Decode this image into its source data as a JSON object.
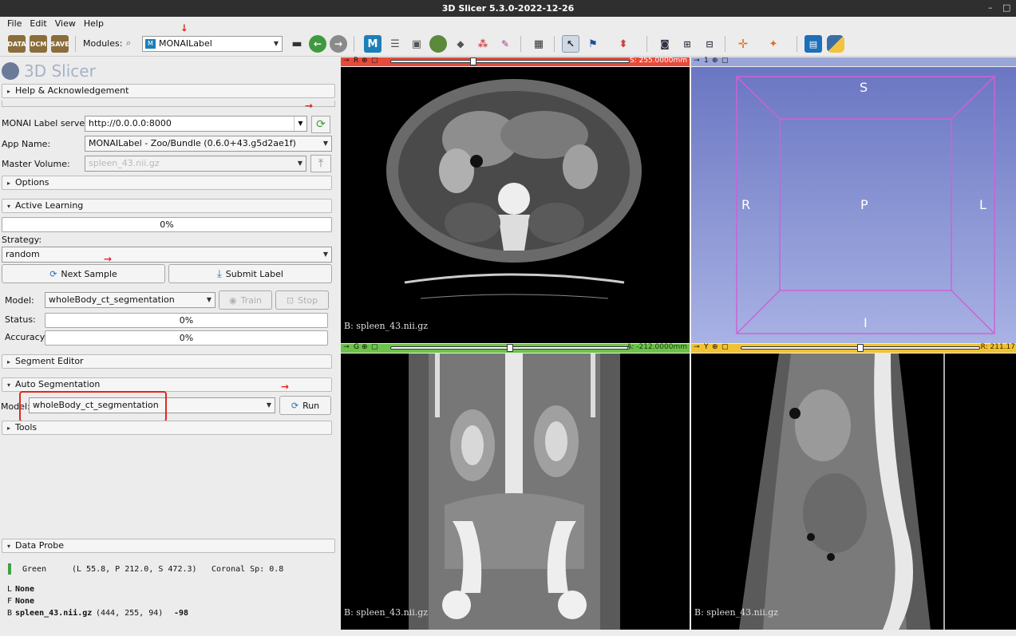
{
  "window": {
    "title": "3D Slicer 5.3.0-2022-12-26",
    "minimize": "–",
    "maximize": "□"
  },
  "menu": {
    "file": "File",
    "edit": "Edit",
    "view": "View",
    "help": "Help"
  },
  "toolbar": {
    "data_label": "DATA",
    "dcm_label": "DCM",
    "save_label": "SAVE",
    "modules_label": "Modules:",
    "module_selected": "MONAILabel",
    "module_icon": "M"
  },
  "logo": {
    "text": "3D Slicer"
  },
  "help_section": "Help & Acknowledgement",
  "server": {
    "label": "MONAI Label server:",
    "value": "http://0.0.0.0:8000"
  },
  "app": {
    "label": "App Name:",
    "value": "MONAILabel - Zoo/Bundle (0.6.0+43.g5d2ae1f)"
  },
  "master": {
    "label": "Master Volume:",
    "value": "spleen_43.nii.gz"
  },
  "options_section": "Options",
  "active_learning": {
    "section": "Active Learning",
    "progress_text": "0%",
    "progress_value": 0,
    "strategy_label": "Strategy:",
    "strategy_value": "random",
    "next_sample": "Next Sample",
    "submit_label": "Submit Label"
  },
  "training": {
    "model_label": "Model:",
    "model_value": "wholeBody_ct_segmentation",
    "train": "Train",
    "stop": "Stop",
    "status_label": "Status:",
    "status_value": "0%",
    "accuracy_label": "Accuracy:",
    "accuracy_value": "0%"
  },
  "segment_editor_section": "Segment Editor",
  "auto_seg": {
    "section": "Auto Segmentation",
    "model_label": "Model:",
    "model_value": "wholeBody_ct_segmentation",
    "run": "Run"
  },
  "tools_section": "Tools",
  "data_probe": {
    "section": "Data Probe",
    "line1_view": "Green",
    "line1_coords": "(L 55.8, P 212.0, S 472.3)",
    "line1_extra": "Coronal Sp: 0.8",
    "l_prefix": "L",
    "l_value": "None",
    "f_prefix": "F",
    "f_value": "None",
    "b_prefix": "B",
    "b_name": "spleen_43.nii.gz",
    "b_ijk": "(444, 255, 94)",
    "b_value": "-98"
  },
  "views": {
    "red": {
      "letter": "R",
      "offset": "S: 255.0000mm",
      "caption": "B: spleen_43.nii.gz",
      "slider": 0.34
    },
    "threed": {
      "id": "1",
      "S": "S",
      "R": "R",
      "P": "P",
      "L": "L",
      "I": "I"
    },
    "green": {
      "letter": "G",
      "offset": "A: -212.0000mm",
      "caption": "B: spleen_43.nii.gz",
      "slider": 0.5
    },
    "yellow": {
      "letter": "Y",
      "offset": "R: 211.17",
      "caption": "B: spleen_43.nii.gz",
      "slider": 0.5
    }
  },
  "colors": {
    "red": "#e74a3b",
    "green": "#6cc24a",
    "yellow": "#f1c232",
    "highlight": "#e0281f"
  }
}
